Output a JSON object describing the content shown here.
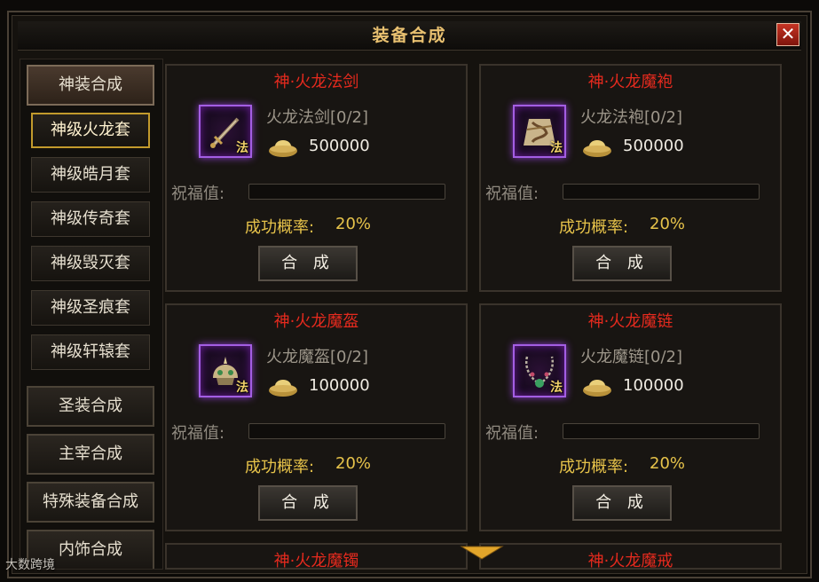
{
  "window": {
    "title": "装备合成",
    "close_glyph": "✕"
  },
  "sidebar": {
    "categories": {
      "shenzhuang": "神装合成",
      "shengzhuang": "圣装合成",
      "zhuzai": "主宰合成",
      "teshu": "特殊装备合成",
      "neishi": "内饰合成"
    },
    "sets": [
      "神级火龙套",
      "神级皓月套",
      "神级传奇套",
      "神级毁灭套",
      "神级圣痕套",
      "神级轩辕套"
    ],
    "selected_set": "神级火龙套"
  },
  "cards": [
    {
      "title": "神·火龙法剑",
      "item_name": "火龙法剑[0/2]",
      "cost": "500000",
      "badge": "法",
      "bless_label": "祝福值:",
      "rate_label": "成功概率:",
      "rate_value": "20%",
      "button": "合 成"
    },
    {
      "title": "神·火龙魔袍",
      "item_name": "火龙法袍[0/2]",
      "cost": "500000",
      "badge": "法",
      "bless_label": "祝福值:",
      "rate_label": "成功概率:",
      "rate_value": "20%",
      "button": "合 成"
    },
    {
      "title": "神·火龙魔盔",
      "item_name": "火龙魔盔[0/2]",
      "cost": "100000",
      "badge": "法",
      "bless_label": "祝福值:",
      "rate_label": "成功概率:",
      "rate_value": "20%",
      "button": "合 成"
    },
    {
      "title": "神·火龙魔链",
      "item_name": "火龙魔链[0/2]",
      "cost": "100000",
      "badge": "法",
      "bless_label": "祝福值:",
      "rate_label": "成功概率:",
      "rate_value": "20%",
      "button": "合 成"
    },
    {
      "title": "神·火龙魔镯"
    },
    {
      "title": "神·火龙魔戒"
    }
  ],
  "watermark": "大数跨境",
  "colors": {
    "title_gold": "#e8c070",
    "item_title_red": "#e52a1e",
    "rate_gold": "#e7c34a",
    "item_border_purple": "#a35ee3",
    "selected_border": "#c29a2c"
  }
}
